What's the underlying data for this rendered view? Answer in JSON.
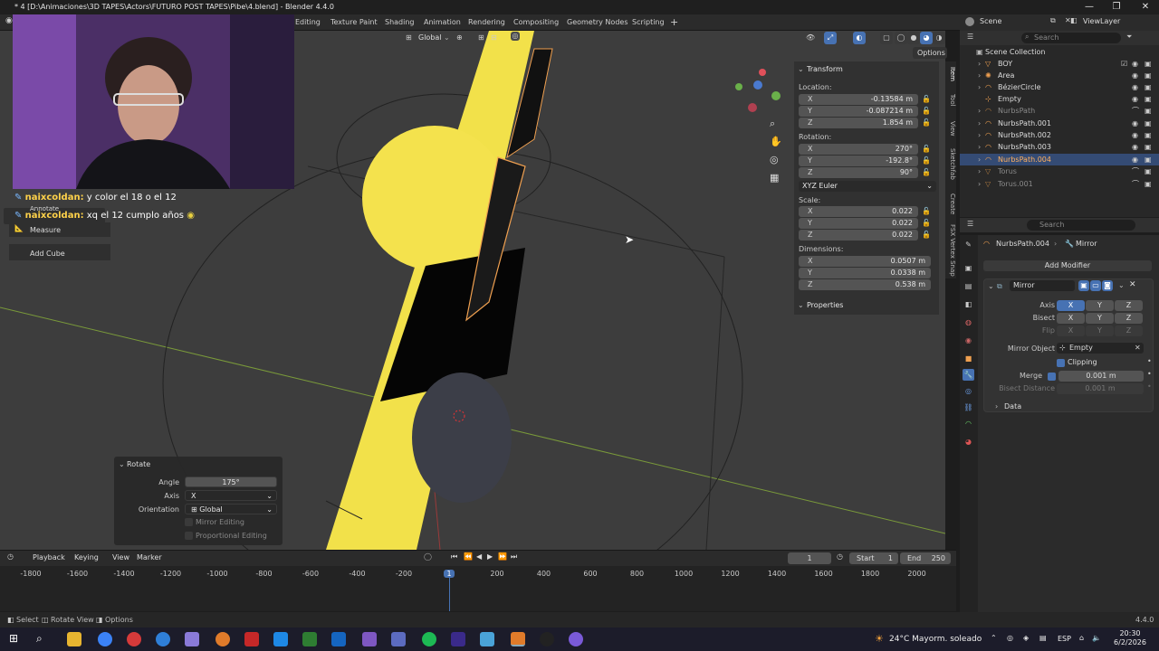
{
  "window": {
    "title": "* 4 [D:\\Animaciones\\3D TAPES\\Actors\\FUTURO POST TAPES\\Pibe\\4.blend] - Blender 4.4.0",
    "controls": [
      "—",
      "❐",
      "✕"
    ]
  },
  "workspaces": [
    "Editing",
    "Texture Paint",
    "Shading",
    "Animation",
    "Rendering",
    "Compositing",
    "Geometry Nodes",
    "Scripting",
    "+"
  ],
  "scene": {
    "name": "Scene",
    "view_layer": "ViewLayer"
  },
  "viewport": {
    "orientation": "Global",
    "options_label": "Options"
  },
  "chat": [
    {
      "user": "naixcoldan:",
      "message": "y color el 18 o el 12"
    },
    {
      "user": "naixcoldan:",
      "message": "xq el 12 cumplo años"
    }
  ],
  "tools": {
    "annotate": "Annotate",
    "measure": "Measure",
    "add_cube": "Add Cube"
  },
  "npanel": {
    "header": "Transform",
    "location_label": "Location:",
    "location": [
      {
        "axis": "X",
        "value": "-0.13584 m"
      },
      {
        "axis": "Y",
        "value": "-0.087214 m"
      },
      {
        "axis": "Z",
        "value": "1.854 m"
      }
    ],
    "rotation_label": "Rotation:",
    "rotation": [
      {
        "axis": "X",
        "value": "270°"
      },
      {
        "axis": "Y",
        "value": "-192.8°"
      },
      {
        "axis": "Z",
        "value": "90°"
      }
    ],
    "rotation_mode": "XYZ Euler",
    "scale_label": "Scale:",
    "scale": [
      {
        "axis": "X",
        "value": "0.022"
      },
      {
        "axis": "Y",
        "value": "0.022"
      },
      {
        "axis": "Z",
        "value": "0.022"
      }
    ],
    "dimensions_label": "Dimensions:",
    "dimensions": [
      {
        "axis": "X",
        "value": "0.0507 m"
      },
      {
        "axis": "Y",
        "value": "0.0338 m"
      },
      {
        "axis": "Z",
        "value": "0.538 m"
      }
    ],
    "properties_header": "Properties",
    "tabs": [
      "Item",
      "Tool",
      "View",
      "Sketchfab",
      "Create",
      "FSX Vertex Snap"
    ]
  },
  "rotate_operator": {
    "title": "Rotate",
    "angle_label": "Angle",
    "angle": "175°",
    "axis_label": "Axis",
    "axis": "X",
    "orientation_label": "Orientation",
    "orientation": "Global",
    "mirror_editing": "Mirror Editing",
    "proportional_editing": "Proportional Editing"
  },
  "outliner": {
    "search_placeholder": "Search",
    "collection": "Scene Collection",
    "items": [
      {
        "name": "BOY"
      },
      {
        "name": "Area"
      },
      {
        "name": "BézierCircle"
      },
      {
        "name": "Empty"
      },
      {
        "name": "NurbsPath"
      },
      {
        "name": "NurbsPath.001"
      },
      {
        "name": "NurbsPath.002"
      },
      {
        "name": "NurbsPath.003"
      },
      {
        "name": "NurbsPath.004"
      },
      {
        "name": "Torus"
      },
      {
        "name": "Torus.001"
      }
    ]
  },
  "properties": {
    "search_placeholder": "Search",
    "object": "NurbsPath.004",
    "context": "Mirror",
    "add_modifier": "Add Modifier",
    "modifier_name": "Mirror",
    "axis_label": "Axis",
    "bisect_label": "Bisect",
    "flip_label": "Flip",
    "xyz": [
      "X",
      "Y",
      "Z"
    ],
    "mirror_object_label": "Mirror Object",
    "mirror_object": "Empty",
    "clipping": "Clipping",
    "merge_label": "Merge",
    "merge_value": "0.001 m",
    "bisect_distance_label": "Bisect Distance",
    "bisect_distance": "0.001 m",
    "data": "Data"
  },
  "timeline": {
    "menus": [
      "Playback",
      "Keying",
      "View",
      "Marker"
    ],
    "current_frame": "1",
    "start_label": "Start",
    "start": "1",
    "end_label": "End",
    "end": "250",
    "ticks": [
      "-1800",
      "-1600",
      "-1400",
      "-1200",
      "-1000",
      "-800",
      "-600",
      "-400",
      "-200",
      "1",
      "200",
      "400",
      "600",
      "800",
      "1000",
      "1200",
      "1400",
      "1600",
      "1800",
      "2000"
    ]
  },
  "statusbar": {
    "select": "Select",
    "rotate_view": "Rotate View",
    "options": "Options",
    "version": "4.4.0"
  },
  "taskbar": {
    "weather": "24°C  Mayorm. soleado",
    "lang": "ESP",
    "time": "20:30",
    "date": "6/2/2026"
  }
}
